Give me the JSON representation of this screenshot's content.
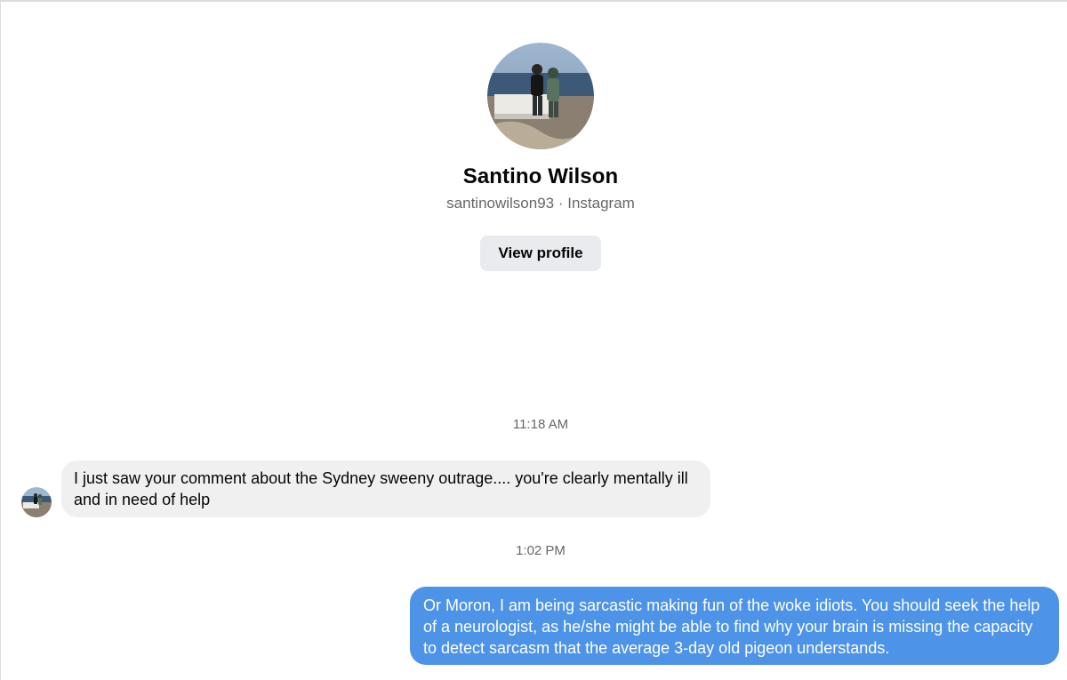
{
  "profile": {
    "name": "Santino Wilson",
    "subtitle": "santinowilson93 · Instagram",
    "view_profile_label": "View profile",
    "avatar_icon": "user-photo-avatar"
  },
  "conversation": {
    "messages": [
      {
        "timestamp": "11:18 AM",
        "direction": "incoming",
        "text": "I just saw your comment about the Sydney sweeny outrage.... you're clearly mentally ill and in need of help"
      },
      {
        "timestamp": "1:02 PM",
        "direction": "outgoing",
        "text": "Or Moron, I am being sarcastic making fun of the woke idiots.  You should seek the help of a neurologist, as he/she might be able to find why your brain is missing the capacity to detect sarcasm that the average 3-day old pigeon understands."
      }
    ]
  },
  "colors": {
    "incoming_bubble": "#f0f0f0",
    "outgoing_bubble": "#4d93e8",
    "secondary_text": "#65676b",
    "button_bg": "#e9ebee"
  }
}
